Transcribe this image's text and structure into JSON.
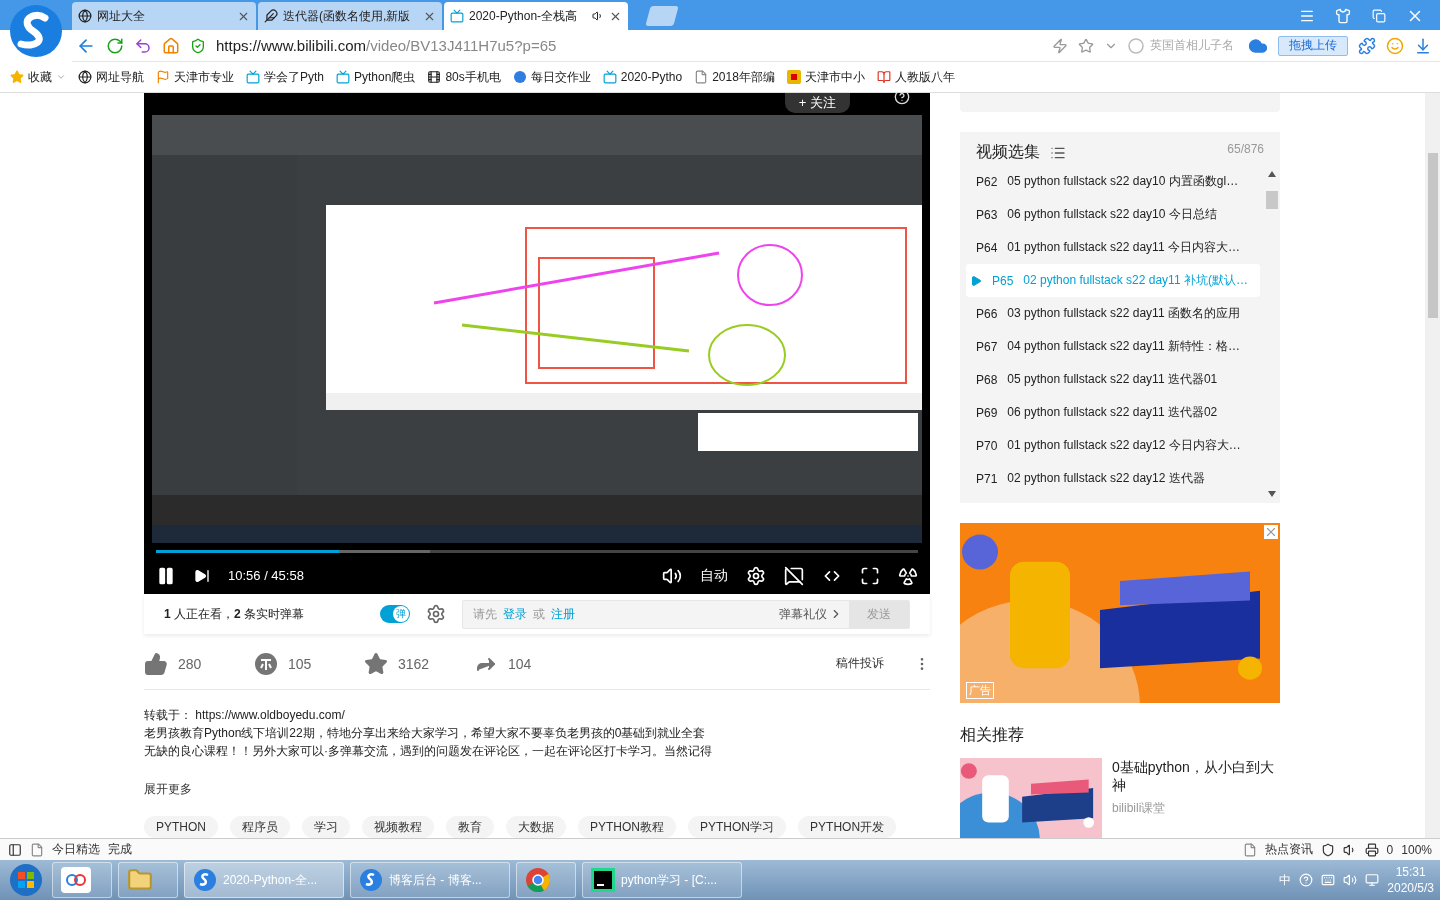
{
  "browser": {
    "tabs": [
      {
        "kind": "globe",
        "title": "网址大全",
        "selected": false
      },
      {
        "kind": "feather",
        "title": "迭代器(函数名使用,新版",
        "selected": false
      },
      {
        "kind": "tv",
        "title": "2020-Python-全栈高",
        "selected": true
      }
    ],
    "url_host": "https://www.bilibili.com",
    "url_path": "/video/BV13J411H7u5?p=65",
    "search_placeholder": "英国首相儿子名",
    "upload_button": "拖拽上传",
    "bookmarks": [
      {
        "kind": "star",
        "label": "收藏"
      },
      {
        "kind": "globe",
        "label": "网址导航"
      },
      {
        "kind": "flag",
        "label": "天津市专业"
      },
      {
        "kind": "tv",
        "label": "学会了Pyth"
      },
      {
        "kind": "tv",
        "label": "Python爬虫"
      },
      {
        "kind": "film",
        "label": "80s手机电"
      },
      {
        "kind": "circle",
        "label": "每日交作业"
      },
      {
        "kind": "tv",
        "label": "2020-Pytho"
      },
      {
        "kind": "file",
        "label": "2018年部编"
      },
      {
        "kind": "s",
        "label": "天津市中小"
      },
      {
        "kind": "book",
        "label": "人教版八年"
      }
    ]
  },
  "video": {
    "follow_button": "+ 关注",
    "progress": {
      "level": 0.24
    },
    "buffer": {
      "level": 0.36
    },
    "time": "10:56 / 45:58",
    "quality": "自动"
  },
  "danmaku": {
    "viewers": "**1** 人正在看，**2** 条实时弹幕",
    "toggle": {
      "label": "弹",
      "on": true
    },
    "prompt": "请先",
    "login": "登录",
    "or": "或",
    "register": "注册",
    "etiquette": "弹幕礼仪",
    "send": "发送"
  },
  "stats": [
    {
      "kind": "like",
      "count": "280"
    },
    {
      "kind": "coin",
      "count": "105"
    },
    {
      "kind": "favorite",
      "count": "3162"
    },
    {
      "kind": "share",
      "count": "104"
    }
  ],
  "report": "稿件投诉",
  "description": {
    "source": "转载于： https://www.oldboyedu.com/",
    "body": "老男孩教育Python线下培训22期，特地分享出来给大家学习，希望大家不要辜负老男孩的0基础到就业全套无缺的良心课程！！另外大家可以·多弹幕交流，遇到的问题发在评论区，一起在评论区打卡学习。当然记得",
    "expand": "展开更多"
  },
  "tags": [
    "PYTHON",
    "程序员",
    "学习",
    "视频教程",
    "教育",
    "大数据",
    "PYTHON教程",
    "PYTHON学习",
    "PYTHON开发"
  ],
  "playlist": {
    "title": "视频选集",
    "progress": "65/876",
    "items": [
      {
        "part": "P62",
        "title": "05 python fullstack s22 day10 内置函数gl…",
        "selected": false
      },
      {
        "part": "P63",
        "title": "06 python fullstack s22 day10 今日总结",
        "selected": false
      },
      {
        "part": "P64",
        "title": "01 python fullstack s22 day11 今日内容大…",
        "selected": false
      },
      {
        "part": "P65",
        "title": "02 python fullstack s22 day11 补坑(默认…",
        "selected": true
      },
      {
        "part": "P66",
        "title": "03 python fullstack s22 day11 函数名的应用",
        "selected": false
      },
      {
        "part": "P67",
        "title": "04 python fullstack s22 day11 新特性：格…",
        "selected": false
      },
      {
        "part": "P68",
        "title": "05 python fullstack s22 day11 迭代器01",
        "selected": false
      },
      {
        "part": "P69",
        "title": "06 python fullstack s22 day11 迭代器02",
        "selected": false
      },
      {
        "part": "P70",
        "title": "01 python fullstack s22 day12 今日内容大…",
        "selected": false
      },
      {
        "part": "P71",
        "title": "02 python fullstack s22 day12 迭代器",
        "selected": false
      }
    ]
  },
  "ad": {
    "badge": "广告"
  },
  "related": {
    "heading": "相关推荐",
    "items": [
      {
        "title": "0基础python，从小白到大神",
        "author": "bilibili课堂"
      }
    ]
  },
  "status_bar": {
    "left": [
      "今日精选",
      "完成"
    ],
    "news": "热点资讯",
    "badge_count": "0",
    "zoom": "100%"
  },
  "taskbar": {
    "tasks": [
      {
        "kind": "browser",
        "label": "2020-Python-全...",
        "selected": true
      },
      {
        "kind": "browser",
        "label": "博客后台 - 博客...",
        "selected": false
      },
      {
        "kind": "chrome",
        "selected": false
      },
      {
        "kind": "ide",
        "label": "python学习 - [C:...",
        "selected": false
      }
    ],
    "ime": "中",
    "time": "15:31",
    "date": "2020/5/3"
  }
}
